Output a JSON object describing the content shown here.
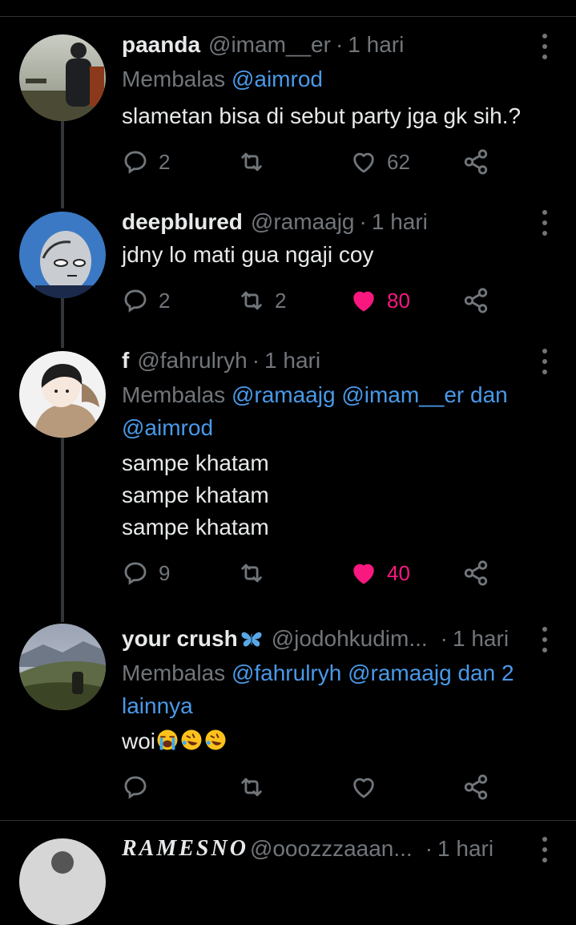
{
  "tweets": [
    {
      "name": "paanda",
      "handle": "@imam__er",
      "separator": "·",
      "time": "1 hari",
      "reply_prefix": "Membalas",
      "reply_mentions": "@aimrod",
      "text": [
        "slametan bisa di sebut party jga gk sih.?"
      ],
      "replies": "2",
      "retweets": "",
      "likes": "62",
      "liked": false
    },
    {
      "name": "deepblured",
      "handle": "@ramaajg",
      "separator": "·",
      "time": "1 hari",
      "text": [
        "jdny lo mati gua ngaji coy"
      ],
      "replies": "2",
      "retweets": "2",
      "likes": "80",
      "liked": true
    },
    {
      "name": "f",
      "handle": "@fahrulryh",
      "separator": "·",
      "time": "1 hari",
      "reply_prefix": "Membalas",
      "reply_mentions_a": "@ramaajg @imam__er dan",
      "reply_mentions_b": "@aimrod",
      "text": [
        "sampe khatam",
        "sampe khatam",
        "sampe khatam"
      ],
      "replies": "9",
      "retweets": "",
      "likes": "40",
      "liked": true
    },
    {
      "name": "your crush",
      "name_emoji": "butterfly-emoji",
      "handle": "@jodohkudim...",
      "separator": "·",
      "time": "1 hari",
      "reply_prefix": "Membalas",
      "reply_mentions_a": "@fahrulryh @ramaajg dan 2",
      "reply_mentions_b": "lainnya",
      "text": [
        "woi"
      ],
      "text_emoji": [
        "loudly-crying-face-emoji",
        "rolling-on-floor-laughing-emoji",
        "rolling-on-floor-laughing-emoji"
      ],
      "replies": "",
      "retweets": "",
      "likes": "",
      "liked": false
    },
    {
      "name": "RAMESNO",
      "handle": "@ooozzzaaan...",
      "separator": "·",
      "time": "1 hari"
    }
  ],
  "icons": {
    "reply": "speech-bubble-icon",
    "retweet": "retweet-icon",
    "like": "heart-icon",
    "share": "share-icon",
    "more": "more-options-icon"
  },
  "colors": {
    "background": "#000000",
    "text": "#e7e9ea",
    "muted": "#71767b",
    "mention": "#4a99e9",
    "like": "#f91880"
  }
}
